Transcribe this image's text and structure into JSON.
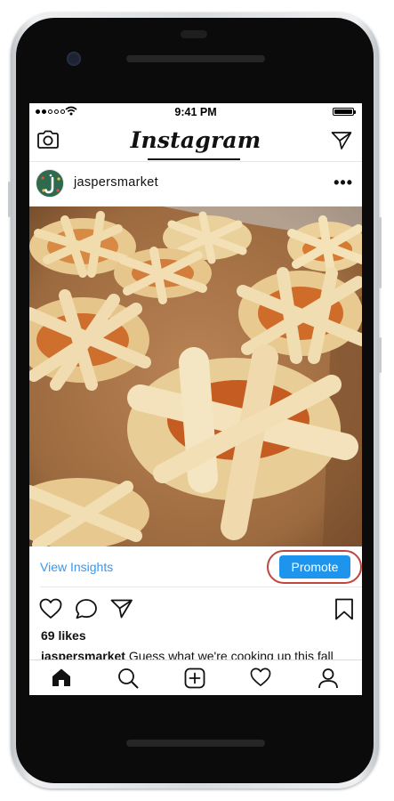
{
  "status_bar": {
    "time": "9:41 PM",
    "signal_bars": 2,
    "battery_level": 1.0
  },
  "app": {
    "logo_text": "Instagram"
  },
  "post": {
    "username": "jaspersmarket",
    "more_label": "•••",
    "view_insights_label": "View Insights",
    "promote_label": "Promote",
    "likes": "69 likes",
    "caption_user": "jaspersmarket",
    "caption_text": "Guess what we're cooking up this fall"
  },
  "icons": {
    "camera": "camera-icon",
    "direct": "paper-plane-icon",
    "like": "heart-icon",
    "comment": "comment-bubble-icon",
    "share": "paper-plane-icon",
    "save": "bookmark-icon",
    "home": "home-icon",
    "search": "search-icon",
    "new_post": "plus-square-icon",
    "activity": "heart-icon",
    "profile": "person-icon"
  },
  "colors": {
    "link_blue": "#3897f0",
    "promote_blue": "#1d95ee",
    "highlight_ring": "#c0453c",
    "avatar_green": "#2f6a4e"
  }
}
